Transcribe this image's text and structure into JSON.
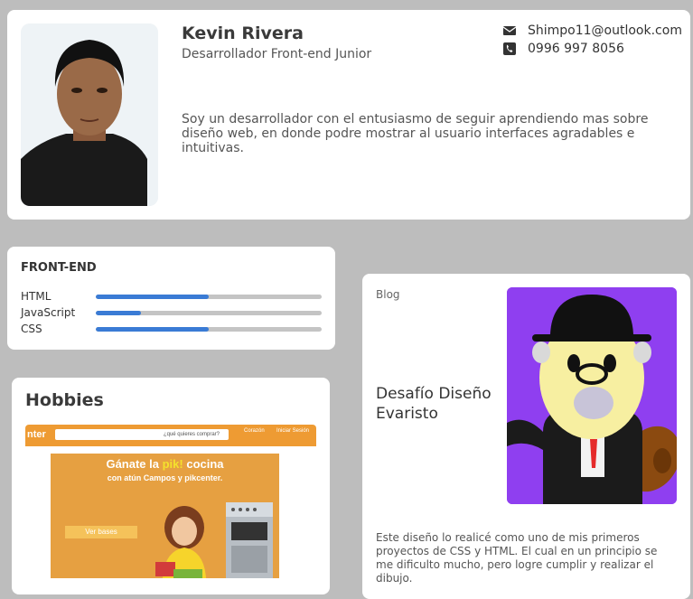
{
  "profile": {
    "name": "Kevin Rivera",
    "role": "Desarrollador Front-end Junior",
    "email": "Shimpo11@outlook.com",
    "phone": "0996 997 8056",
    "bio": "Soy un desarrollador con el entusiasmo de seguir aprendiendo mas sobre diseño web, en donde podre mostrar al usuario interfaces agradables e intuitivas.",
    "icons": {
      "email": "envelope-icon",
      "phone": "phone-icon"
    }
  },
  "skills": {
    "title": "FRONT-END",
    "items": [
      {
        "label": "HTML",
        "level": 0.5
      },
      {
        "label": "JavaScript",
        "level": 0.2
      },
      {
        "label": "CSS",
        "level": 0.5
      }
    ],
    "colors": {
      "fill": "#3a7bd5",
      "track": "#c4c4c4"
    }
  },
  "hobbies": {
    "title": "Hobbies",
    "preview": {
      "logo": "nter",
      "search_placeholder": "¿qué quieres comprar?",
      "link_corazon": "Corazón",
      "link_login": "Iniciar Sesión",
      "headline_a": "Gánate la ",
      "headline_pik": "pik!",
      "headline_b": " cocina",
      "subline": "con atún Campos y pikcenter.",
      "button": "Ver bases"
    }
  },
  "blog": {
    "tag": "Blog",
    "title": "Desafío Diseño Evaristo",
    "description": "Este diseño lo realicé como uno de mis primeros proyectos de CSS y HTML. El cual en un principio se me dificulto mucho, pero logre cumplir y realizar el dibujo."
  },
  "colors": {
    "background": "#bdbdbd",
    "card": "#ffffff",
    "accent": "#3a7bd5",
    "blog_image_bg": "#8f3ff0"
  }
}
